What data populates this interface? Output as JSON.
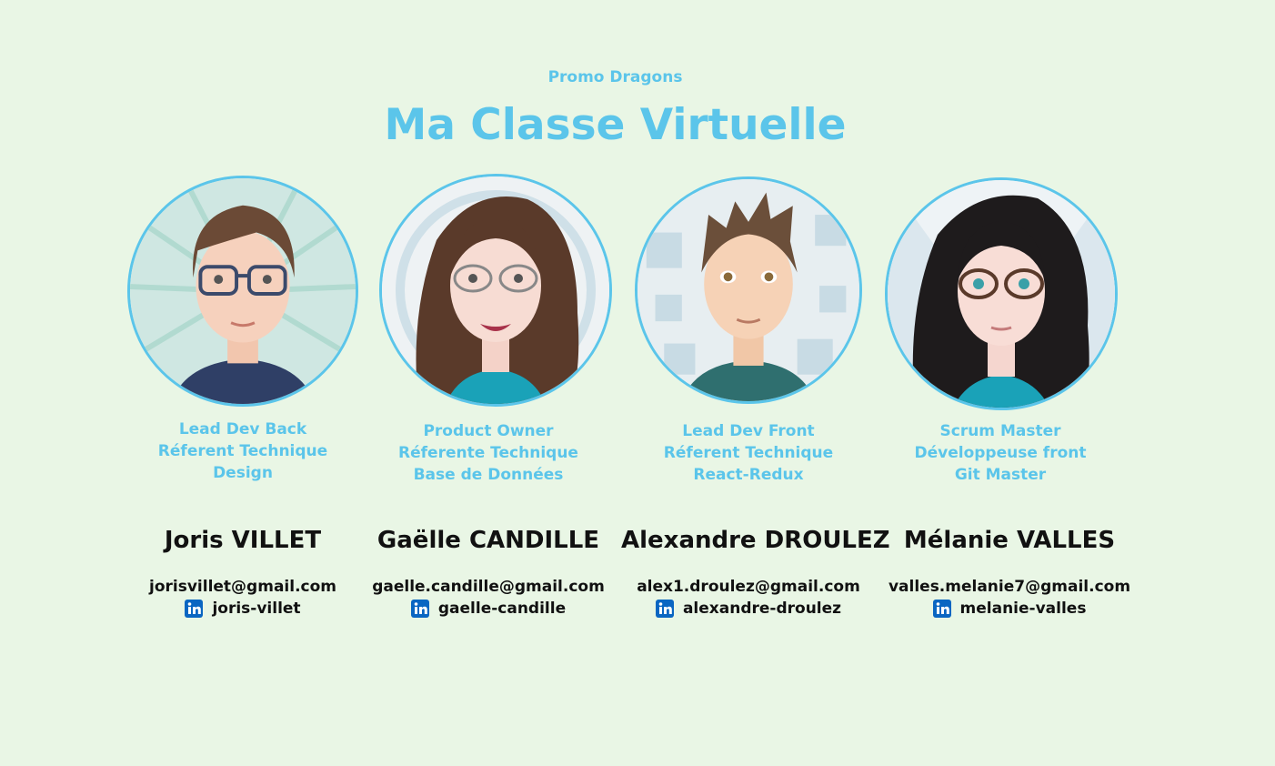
{
  "header": {
    "promo": "Promo Dragons",
    "title": "Ma Classe Virtuelle"
  },
  "colors": {
    "background": "#e9f6e5",
    "accent": "#5bc5ea",
    "text": "#111111",
    "linkedin": "#0a66c2"
  },
  "members": [
    {
      "roles": [
        "Lead Dev Back",
        "Réferent Technique",
        "Design"
      ],
      "name": "Joris VILLET",
      "email": "jorisvillet@gmail.com",
      "linkedin": "joris-villet",
      "linkedin_icon": "linkedin-icon",
      "avatar": "avatar-joris"
    },
    {
      "roles": [
        "Product Owner",
        "Réferente Technique",
        "Base de Données"
      ],
      "name": "Gaëlle CANDILLE",
      "email": "gaelle.candille@gmail.com",
      "linkedin": "gaelle-candille",
      "linkedin_icon": "linkedin-icon",
      "avatar": "avatar-gaelle"
    },
    {
      "roles": [
        "Lead Dev Front",
        "Réferent Technique",
        "React-Redux"
      ],
      "name": "Alexandre DROULEZ",
      "email": "alex1.droulez@gmail.com",
      "linkedin": "alexandre-droulez",
      "linkedin_icon": "linkedin-icon",
      "avatar": "avatar-alexandre"
    },
    {
      "roles": [
        "Scrum Master",
        "Développeuse front",
        "Git Master"
      ],
      "name": "Mélanie VALLES",
      "email": "valles.melanie7@gmail.com",
      "linkedin": "melanie-valles",
      "linkedin_icon": "linkedin-icon",
      "avatar": "avatar-melanie"
    }
  ]
}
